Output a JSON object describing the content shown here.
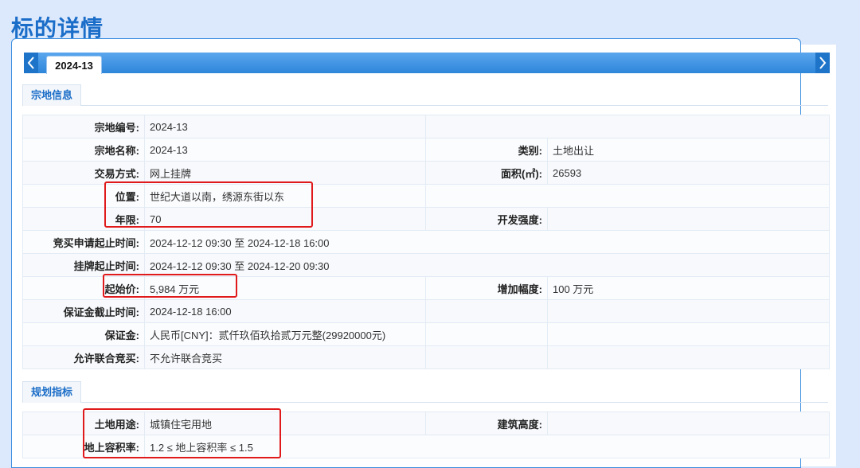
{
  "page_title": "标的详情",
  "tabs": {
    "active": "2024-13"
  },
  "section1": {
    "title": "宗地信息",
    "rows": [
      {
        "l1": "宗地编号:",
        "v1": "2024-13",
        "l2": "",
        "v2": ""
      },
      {
        "l1": "宗地名称:",
        "v1": "2024-13",
        "l2": "类别:",
        "v2": "土地出让"
      },
      {
        "l1": "交易方式:",
        "v1": "网上挂牌",
        "l2": "面积(㎡):",
        "v2": "26593"
      },
      {
        "l1": "位置:",
        "v1": "世纪大道以南，绣源东街以东",
        "l2": "",
        "v2": ""
      },
      {
        "l1": "年限:",
        "v1": "70",
        "l2": "开发强度:",
        "v2": ""
      },
      {
        "l1": "竞买申请起止时间:",
        "v1": "2024-12-12 09:30 至 2024-12-18 16:00"
      },
      {
        "l1": "挂牌起止时间:",
        "v1": "2024-12-12 09:30 至 2024-12-20 09:30"
      },
      {
        "l1": "起始价:",
        "v1": "5,984 万元",
        "l2": "增加幅度:",
        "v2": "100 万元"
      },
      {
        "l1": "保证金截止时间:",
        "v1": "2024-12-18 16:00",
        "l2": "",
        "v2": ""
      },
      {
        "l1": "保证金:",
        "v1": "人民币[CNY]：贰仟玖佰玖拾贰万元整(29920000元)",
        "l2": "",
        "v2": ""
      },
      {
        "l1": "允许联合竞买:",
        "v1": "不允许联合竞买",
        "l2": "",
        "v2": ""
      }
    ]
  },
  "section2": {
    "title": "规划指标",
    "rows": [
      {
        "l1": "土地用途:",
        "v1": "城镇住宅用地",
        "l2": "建筑高度:",
        "v2": ""
      },
      {
        "l1": "地上容积率:",
        "v1": "1.2 ≤ 地上容积率 ≤ 1.5"
      }
    ]
  },
  "highlight_color": "#e0191b",
  "accent_color": "#1a6dc8"
}
